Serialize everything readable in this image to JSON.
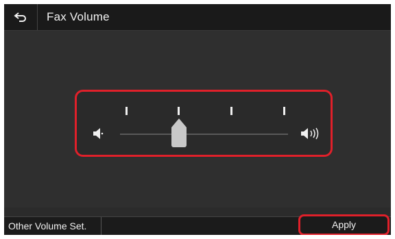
{
  "header": {
    "title": "Fax Volume",
    "back_icon": "back-arrow-icon"
  },
  "volume_slider": {
    "level": 2,
    "min": 1,
    "max": 5,
    "low_icon": "speaker-low-icon",
    "high_icon": "speaker-high-icon"
  },
  "footer": {
    "other_label": "Other Volume Set.",
    "apply_label": "Apply"
  },
  "colors": {
    "highlight": "#e0202a",
    "background": "#2b2b2b"
  }
}
